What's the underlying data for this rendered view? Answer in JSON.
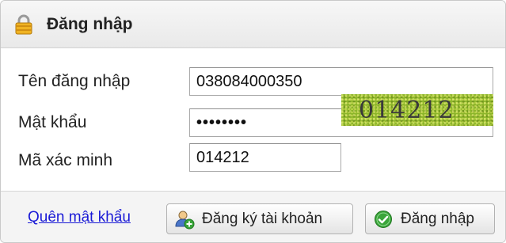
{
  "header": {
    "title": "Đăng nhập",
    "icon": "lock-icon"
  },
  "form": {
    "username_label": "Tên đăng nhập",
    "username_value": "038084000350",
    "password_label": "Mật khẩu",
    "password_masked": "••••••••",
    "captcha_label": "Mã xác minh",
    "captcha_value": "014212",
    "captcha_image_text": "014212"
  },
  "footer": {
    "forgot_link": "Quên mật khẩu",
    "register_button": "Đăng ký tài khoản",
    "register_icon": "add-user-icon",
    "login_button": "Đăng nhập",
    "login_icon": "check-circle-icon"
  },
  "colors": {
    "link": "#1a1ad6",
    "captcha_bg": "#8cb52a",
    "check_green": "#3aa53a"
  }
}
